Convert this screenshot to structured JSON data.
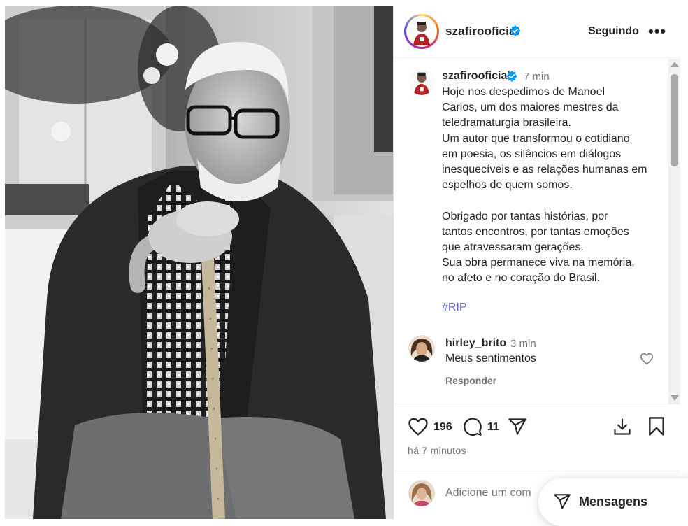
{
  "header": {
    "username": "szafirooficial",
    "follow_label": "Seguindo",
    "more_label": "•••"
  },
  "caption": {
    "username": "szafirooficial",
    "time": "7 min",
    "text": "Hoje nos despedimos de Manoel\nCarlos, um dos maiores mestres da\nteledramaturgia brasileira.\nUm autor que transformou o cotidiano\nem poesia, os silêncios em diálogos\ninesquecíveis e as relações humanas em\nespelhos de quem somos.\n\nObrigado por tantas histórias, por\ntantos encontros, por tantas emoções\nque atravessaram gerações.\nSua obra permanece viva na memória,\nno afeto e no coração do Brasil.",
    "hashtag": "#RIP"
  },
  "comment": {
    "username": "hirley_brito",
    "time": "3 min",
    "text": "Meus sentimentos",
    "reply_label": "Responder"
  },
  "actions": {
    "likes": "196",
    "comments": "11",
    "posted_ago": "há 7 minutos"
  },
  "add_comment": {
    "placeholder": "Adicione um com"
  },
  "messages_label": "Mensagens",
  "colors": {
    "verified": "#0095f6",
    "hashtag": "#5b6fb8",
    "secondary_text": "#737373"
  }
}
